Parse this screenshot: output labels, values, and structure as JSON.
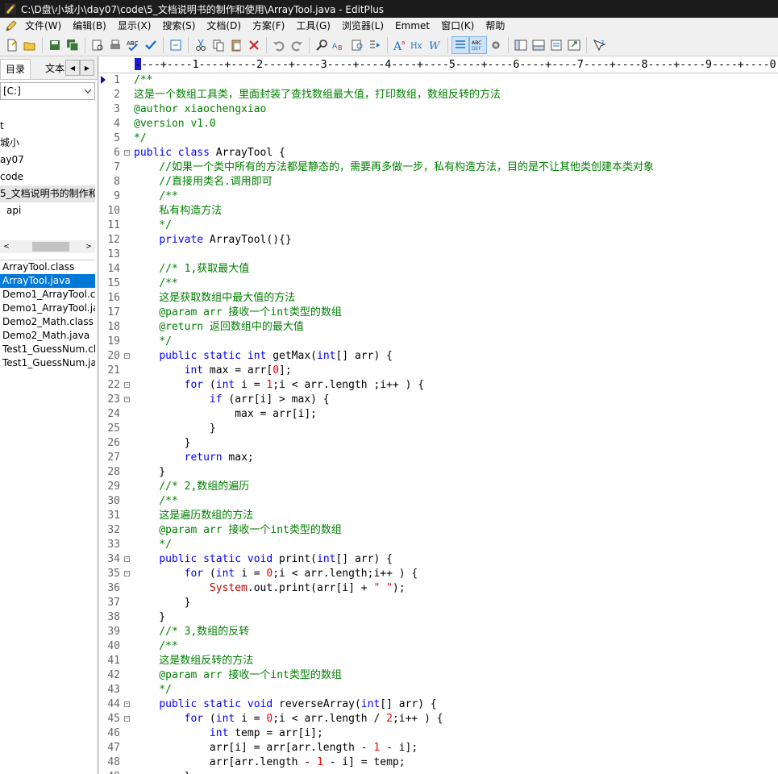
{
  "window": {
    "title": "C:\\D盘\\小城小\\day07\\code\\5_文档说明书的制作和使用\\ArrayTool.java - EditPlus"
  },
  "menu": [
    "文件(W)",
    "编辑(B)",
    "显示(X)",
    "搜索(S)",
    "文档(D)",
    "方案(F)",
    "工具(G)",
    "浏览器(L)",
    "Emmet",
    "窗口(K)",
    "帮助"
  ],
  "toolbar": {
    "icons": [
      "new-file-icon",
      "open-icon",
      "save-icon",
      "save-all-icon",
      "print-preview-icon",
      "print-icon",
      "spellcheck-icon",
      "check-icon",
      "browser-icon",
      "cut-icon",
      "copy-icon",
      "paste-icon",
      "delete-icon",
      "undo-icon",
      "redo-icon",
      "find-icon",
      "replace-icon",
      "find-in-files-icon",
      "goto-icon",
      "font-icon",
      "hex-icon",
      "word-wrap-icon",
      "line-number-icon",
      "column-marker-icon",
      "settings-icon",
      "dir-window-icon",
      "output-window-icon",
      "cliptext-icon",
      "fullscreen-icon",
      "help-icon"
    ]
  },
  "sidebar": {
    "tabs": [
      "目录",
      "文本"
    ],
    "drive": "[C:]",
    "folders": [
      "t",
      "城小",
      "ay07",
      "code",
      "5_文档说明书的制作和",
      "api"
    ],
    "selected_folder_index": 4,
    "files": [
      "ArrayTool.class",
      "ArrayTool.java",
      "Demo1_ArrayTool.c",
      "Demo1_ArrayTool.ja",
      "Demo2_Math.class",
      "Demo2_Math.java",
      "Test1_GuessNum.cla",
      "Test1_GuessNum.ja"
    ],
    "selected_file_index": 1
  },
  "editor": {
    "ruler": "----+----1----+----2----+----3----+----4----+----5----+----6----+----7----+----8----+----9----+----0",
    "lines": [
      {
        "n": "1",
        "fold": false,
        "tokens": [
          [
            "cm",
            "/**"
          ]
        ]
      },
      {
        "n": "2",
        "fold": false,
        "tokens": [
          [
            "cm",
            "这是一个数组工具类，里面封装了查找数组最大值，打印数组，数组反转的方法"
          ]
        ]
      },
      {
        "n": "3",
        "fold": false,
        "tokens": [
          [
            "cm",
            "@author xiaochengxiao"
          ]
        ]
      },
      {
        "n": "4",
        "fold": false,
        "tokens": [
          [
            "cm",
            "@version v1.0"
          ]
        ]
      },
      {
        "n": "5",
        "fold": false,
        "tokens": [
          [
            "cm",
            "*/"
          ]
        ]
      },
      {
        "n": "6",
        "fold": true,
        "tokens": [
          [
            "kw",
            "public class"
          ],
          [
            "pl",
            " ArrayTool {"
          ]
        ]
      },
      {
        "n": "7",
        "fold": false,
        "tokens": [
          [
            "cm",
            "    //如果一个类中所有的方法都是静态的，需要再多做一步，私有构造方法，目的是不让其他类创建本类对象"
          ]
        ]
      },
      {
        "n": "8",
        "fold": false,
        "tokens": [
          [
            "cm",
            "    //直接用类名.调用即可"
          ]
        ]
      },
      {
        "n": "9",
        "fold": false,
        "tokens": [
          [
            "cm",
            "    /**"
          ]
        ]
      },
      {
        "n": "10",
        "fold": false,
        "tokens": [
          [
            "cm",
            "    私有构造方法"
          ]
        ]
      },
      {
        "n": "11",
        "fold": false,
        "tokens": [
          [
            "cm",
            "    */"
          ]
        ]
      },
      {
        "n": "12",
        "fold": false,
        "tokens": [
          [
            "pl",
            "    "
          ],
          [
            "kw",
            "private"
          ],
          [
            "pl",
            " ArrayTool(){}"
          ]
        ]
      },
      {
        "n": "13",
        "fold": false,
        "tokens": []
      },
      {
        "n": "14",
        "fold": false,
        "tokens": [
          [
            "cm",
            "    //* 1,获取最大值"
          ]
        ]
      },
      {
        "n": "15",
        "fold": false,
        "tokens": [
          [
            "cm",
            "    /**"
          ]
        ]
      },
      {
        "n": "16",
        "fold": false,
        "tokens": [
          [
            "cm",
            "    这是获取数组中最大值的方法"
          ]
        ]
      },
      {
        "n": "17",
        "fold": false,
        "tokens": [
          [
            "cm",
            "    @param arr 接收一个int类型的数组"
          ]
        ]
      },
      {
        "n": "18",
        "fold": false,
        "tokens": [
          [
            "cm",
            "    @return 返回数组中的最大值"
          ]
        ]
      },
      {
        "n": "19",
        "fold": false,
        "tokens": [
          [
            "cm",
            "    */"
          ]
        ]
      },
      {
        "n": "20",
        "fold": true,
        "tokens": [
          [
            "pl",
            "    "
          ],
          [
            "kw",
            "public static int"
          ],
          [
            "pl",
            " getMax("
          ],
          [
            "kw",
            "int"
          ],
          [
            "pl",
            "[] arr) {"
          ]
        ]
      },
      {
        "n": "21",
        "fold": false,
        "tokens": [
          [
            "pl",
            "        "
          ],
          [
            "kw",
            "int"
          ],
          [
            "pl",
            " max = arr["
          ],
          [
            "nm",
            "0"
          ],
          [
            "pl",
            "];"
          ]
        ]
      },
      {
        "n": "22",
        "fold": true,
        "tokens": [
          [
            "pl",
            "        "
          ],
          [
            "kw",
            "for"
          ],
          [
            "pl",
            " ("
          ],
          [
            "kw",
            "int"
          ],
          [
            "pl",
            " i = "
          ],
          [
            "nm",
            "1"
          ],
          [
            "pl",
            ";i < arr.length ;i++ ) {"
          ]
        ]
      },
      {
        "n": "23",
        "fold": true,
        "tokens": [
          [
            "pl",
            "            "
          ],
          [
            "kw",
            "if"
          ],
          [
            "pl",
            " (arr[i] > max) {"
          ]
        ]
      },
      {
        "n": "24",
        "fold": false,
        "tokens": [
          [
            "pl",
            "                max = arr[i];"
          ]
        ]
      },
      {
        "n": "25",
        "fold": false,
        "tokens": [
          [
            "pl",
            "            }"
          ]
        ]
      },
      {
        "n": "26",
        "fold": false,
        "tokens": [
          [
            "pl",
            "        }"
          ]
        ]
      },
      {
        "n": "27",
        "fold": false,
        "tokens": [
          [
            "pl",
            "        "
          ],
          [
            "kw",
            "return"
          ],
          [
            "pl",
            " max;"
          ]
        ]
      },
      {
        "n": "28",
        "fold": false,
        "tokens": [
          [
            "pl",
            "    }"
          ]
        ]
      },
      {
        "n": "29",
        "fold": false,
        "tokens": [
          [
            "cm",
            "    //* 2,数组的遍历"
          ]
        ]
      },
      {
        "n": "30",
        "fold": false,
        "tokens": [
          [
            "cm",
            "    /**"
          ]
        ]
      },
      {
        "n": "31",
        "fold": false,
        "tokens": [
          [
            "cm",
            "    这是遍历数组的方法"
          ]
        ]
      },
      {
        "n": "32",
        "fold": false,
        "tokens": [
          [
            "cm",
            "    @param arr 接收一个int类型的数组"
          ]
        ]
      },
      {
        "n": "33",
        "fold": false,
        "tokens": [
          [
            "cm",
            "    */"
          ]
        ]
      },
      {
        "n": "34",
        "fold": true,
        "tokens": [
          [
            "pl",
            "    "
          ],
          [
            "kw",
            "public static void"
          ],
          [
            "pl",
            " print("
          ],
          [
            "kw",
            "int"
          ],
          [
            "pl",
            "[] arr) {"
          ]
        ]
      },
      {
        "n": "35",
        "fold": true,
        "tokens": [
          [
            "pl",
            "        "
          ],
          [
            "kw",
            "for"
          ],
          [
            "pl",
            " ("
          ],
          [
            "kw",
            "int"
          ],
          [
            "pl",
            " i = "
          ],
          [
            "nm",
            "0"
          ],
          [
            "pl",
            ";i < arr.length;i++ ) {"
          ]
        ]
      },
      {
        "n": "36",
        "fold": false,
        "tokens": [
          [
            "pl",
            "            "
          ],
          [
            "sy",
            "System"
          ],
          [
            "pl",
            ".out.print(arr[i] + "
          ],
          [
            "st",
            "\" \""
          ],
          [
            "pl",
            ");"
          ]
        ]
      },
      {
        "n": "37",
        "fold": false,
        "tokens": [
          [
            "pl",
            "        }"
          ]
        ]
      },
      {
        "n": "38",
        "fold": false,
        "tokens": [
          [
            "pl",
            "    }"
          ]
        ]
      },
      {
        "n": "39",
        "fold": false,
        "tokens": [
          [
            "cm",
            "    //* 3,数组的反转"
          ]
        ]
      },
      {
        "n": "40",
        "fold": false,
        "tokens": [
          [
            "cm",
            "    /**"
          ]
        ]
      },
      {
        "n": "41",
        "fold": false,
        "tokens": [
          [
            "cm",
            "    这是数组反转的方法"
          ]
        ]
      },
      {
        "n": "42",
        "fold": false,
        "tokens": [
          [
            "cm",
            "    @param arr 接收一个int类型的数组"
          ]
        ]
      },
      {
        "n": "43",
        "fold": false,
        "tokens": [
          [
            "cm",
            "    */"
          ]
        ]
      },
      {
        "n": "44",
        "fold": true,
        "tokens": [
          [
            "pl",
            "    "
          ],
          [
            "kw",
            "public static void"
          ],
          [
            "pl",
            " reverseArray("
          ],
          [
            "kw",
            "int"
          ],
          [
            "pl",
            "[] arr) {"
          ]
        ]
      },
      {
        "n": "45",
        "fold": true,
        "tokens": [
          [
            "pl",
            "        "
          ],
          [
            "kw",
            "for"
          ],
          [
            "pl",
            " ("
          ],
          [
            "kw",
            "int"
          ],
          [
            "pl",
            " i = "
          ],
          [
            "nm",
            "0"
          ],
          [
            "pl",
            ";i < arr.length / "
          ],
          [
            "nm",
            "2"
          ],
          [
            "pl",
            ";i++ ) {"
          ]
        ]
      },
      {
        "n": "46",
        "fold": false,
        "tokens": [
          [
            "pl",
            "            "
          ],
          [
            "kw",
            "int"
          ],
          [
            "pl",
            " temp = arr[i];"
          ]
        ]
      },
      {
        "n": "47",
        "fold": false,
        "tokens": [
          [
            "pl",
            "            arr[i] = arr[arr.length - "
          ],
          [
            "nm",
            "1"
          ],
          [
            "pl",
            " - i];"
          ]
        ]
      },
      {
        "n": "48",
        "fold": false,
        "tokens": [
          [
            "pl",
            "            arr[arr.length - "
          ],
          [
            "nm",
            "1"
          ],
          [
            "pl",
            " - i] = temp;"
          ]
        ]
      },
      {
        "n": "49",
        "fold": false,
        "tokens": [
          [
            "pl",
            "        }"
          ]
        ]
      }
    ]
  }
}
